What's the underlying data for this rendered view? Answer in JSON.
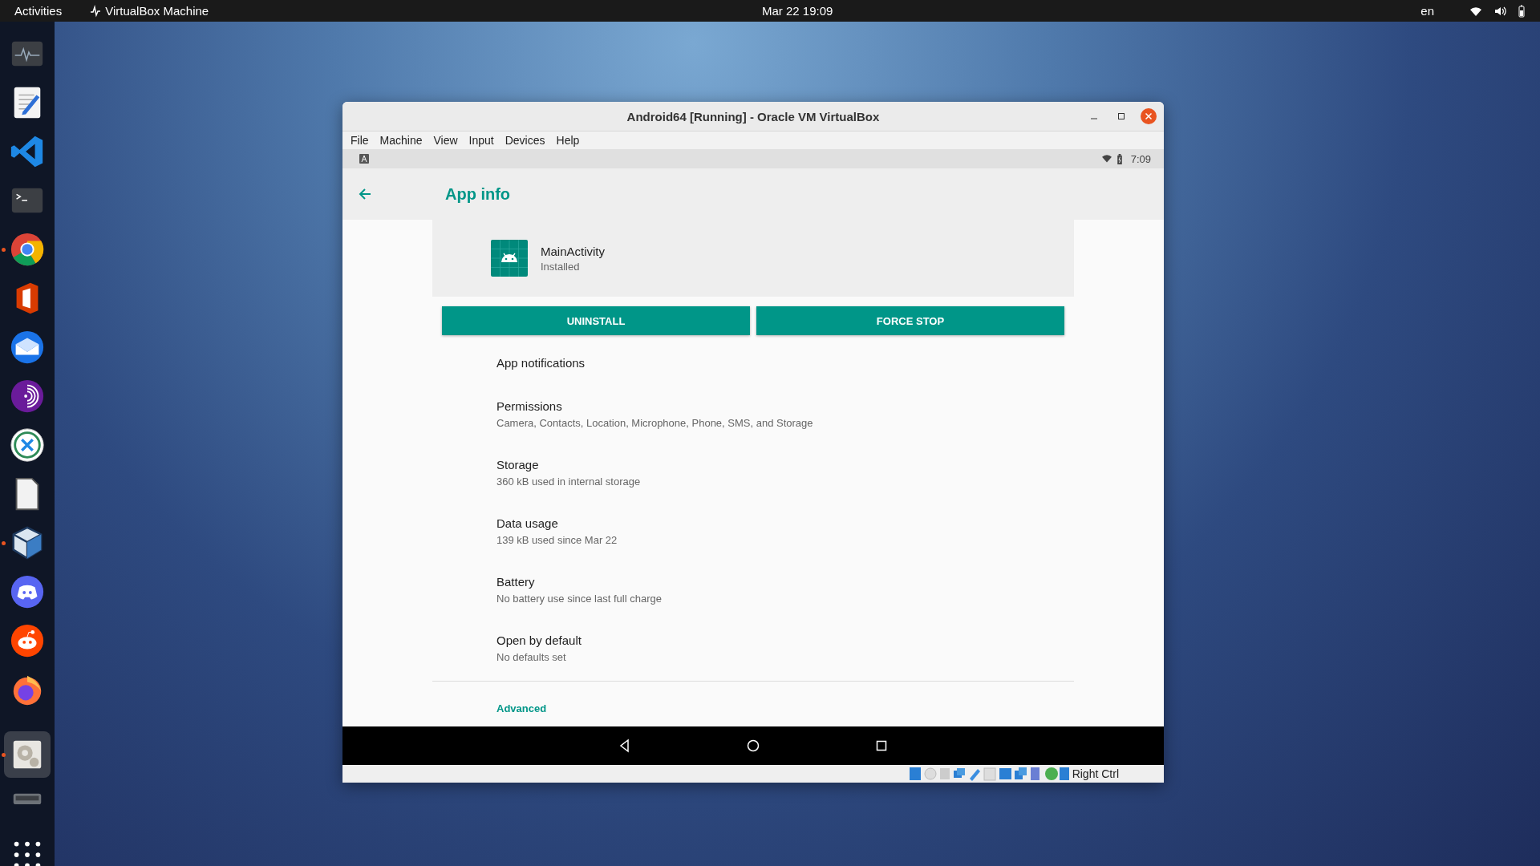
{
  "top_bar": {
    "activities": "Activities",
    "app_name": "VirtualBox Machine",
    "clock": "Mar 22  19:09",
    "language": "en"
  },
  "dock": {
    "items": [
      {
        "kind": "monitor",
        "running": false,
        "selected": false
      },
      {
        "kind": "editor",
        "running": false,
        "selected": false
      },
      {
        "kind": "code",
        "running": false,
        "selected": false
      },
      {
        "kind": "terminal",
        "running": false,
        "selected": false
      },
      {
        "kind": "browser",
        "running": true,
        "selected": false
      },
      {
        "kind": "office",
        "running": false,
        "selected": false
      },
      {
        "kind": "mail",
        "running": false,
        "selected": false
      },
      {
        "kind": "podcast",
        "running": false,
        "selected": false
      },
      {
        "kind": "remote",
        "running": false,
        "selected": false
      },
      {
        "kind": "document",
        "running": false,
        "selected": false
      },
      {
        "kind": "cube",
        "running": true,
        "selected": false
      },
      {
        "kind": "chat",
        "running": false,
        "selected": false
      },
      {
        "kind": "reddit",
        "running": false,
        "selected": false
      },
      {
        "kind": "fox",
        "running": false,
        "selected": false
      },
      {
        "kind": "settings",
        "running": true,
        "selected": true
      },
      {
        "kind": "drive",
        "running": false,
        "selected": false
      },
      {
        "kind": "apps",
        "running": false,
        "selected": false
      }
    ]
  },
  "window": {
    "title": "Android64 [Running] - Oracle VM VirtualBox",
    "menu": [
      "File",
      "Machine",
      "View",
      "Input",
      "Devices",
      "Help"
    ],
    "android": {
      "status_time": "7:09",
      "app_bar_title": "App info",
      "app": {
        "name": "MainActivity",
        "status": "Installed"
      },
      "buttons": [
        "UNINSTALL",
        "FORCE STOP"
      ],
      "settings": [
        {
          "title": "App notifications"
        },
        {
          "title": "Permissions",
          "summary": "Camera, Contacts, Location, Microphone, Phone, SMS, and Storage"
        },
        {
          "title": "Storage",
          "summary": "360 kB used in internal storage"
        },
        {
          "title": "Data usage",
          "summary": "139 kB used since Mar 22"
        },
        {
          "title": "Battery",
          "summary": "No battery use since last full charge"
        },
        {
          "title": "Open by default",
          "summary": "No defaults set"
        }
      ],
      "advanced": "Advanced"
    },
    "status_bar": {
      "host_key": "Right Ctrl"
    }
  }
}
